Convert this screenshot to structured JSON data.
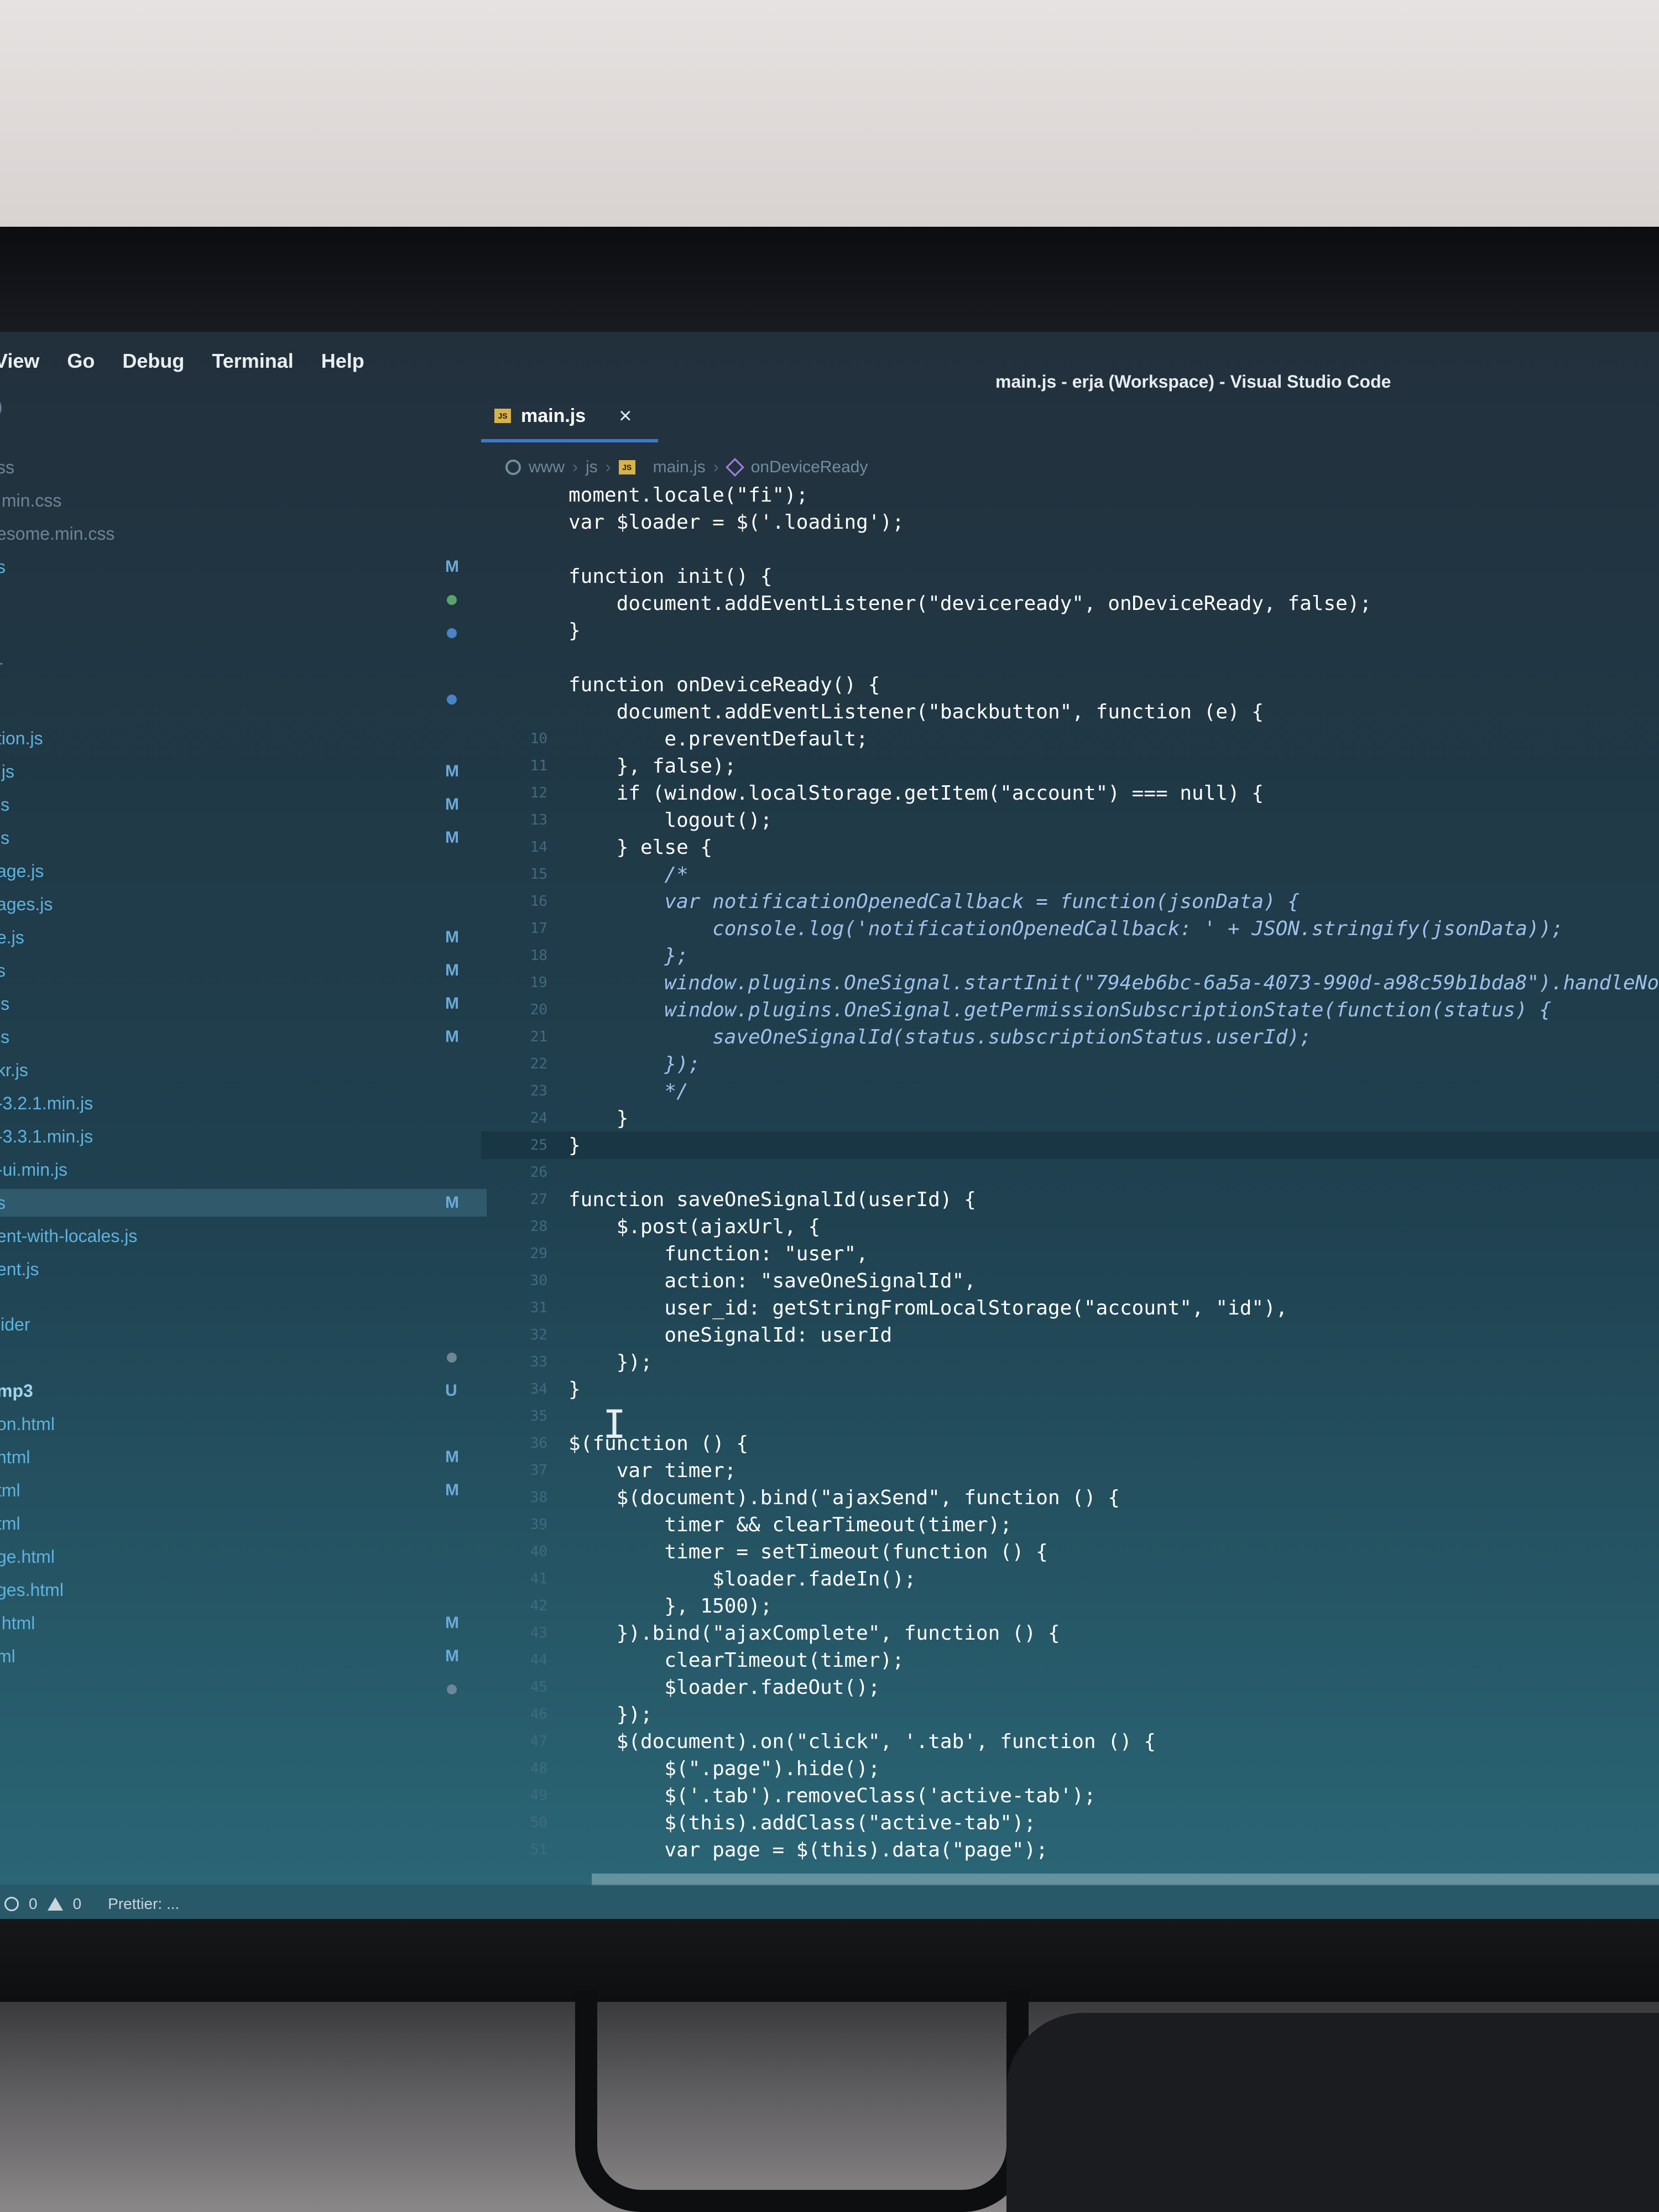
{
  "menu": [
    "View",
    "Go",
    "Debug",
    "Terminal",
    "Help"
  ],
  "window_title": "main.js - erja (Workspace) - Visual Studio Code",
  "tab": {
    "label": "main.js",
    "close": "×"
  },
  "breadcrumb": {
    "folder1": "www",
    "folder2": "js",
    "file": "main.js",
    "symbol": "onDeviceReady"
  },
  "sidebar": [
    {
      "name": ")",
      "status": "",
      "style": "dim"
    },
    {
      "name": "ss",
      "status": "",
      "style": "dim"
    },
    {
      "name": ".min.css",
      "status": "",
      "style": "dim"
    },
    {
      "name": "esome.min.css",
      "status": "",
      "style": "dim"
    },
    {
      "name": "s",
      "status": "M",
      "style": ""
    },
    {
      "name": "",
      "status": "dot-green",
      "style": ""
    },
    {
      "name": "",
      "status": "dot",
      "style": ""
    },
    {
      "name": "r",
      "status": "",
      "style": "dim"
    },
    {
      "name": "",
      "status": "dot",
      "style": ""
    },
    {
      "name": "tion.js",
      "status": "",
      "style": ""
    },
    {
      "name": ".js",
      "status": "M",
      "style": ""
    },
    {
      "name": "js",
      "status": "M",
      "style": ""
    },
    {
      "name": "js",
      "status": "M",
      "style": ""
    },
    {
      "name": "age.js",
      "status": "",
      "style": ""
    },
    {
      "name": "ages.js",
      "status": "",
      "style": ""
    },
    {
      "name": "e.js",
      "status": "M",
      "style": ""
    },
    {
      "name": "s",
      "status": "M",
      "style": ""
    },
    {
      "name": "js",
      "status": "M",
      "style": ""
    },
    {
      "name": "js",
      "status": "M",
      "style": ""
    },
    {
      "name": "kr.js",
      "status": "",
      "style": ""
    },
    {
      "name": "-3.2.1.min.js",
      "status": "",
      "style": ""
    },
    {
      "name": "-3.3.1.min.js",
      "status": "",
      "style": ""
    },
    {
      "name": "-ui.min.js",
      "status": "",
      "style": ""
    },
    {
      "name": "s",
      "status": "M",
      "style": "selected"
    },
    {
      "name": "ent-with-locales.js",
      "status": "",
      "style": ""
    },
    {
      "name": "ent.js",
      "status": "",
      "style": ""
    },
    {
      "name": "lider",
      "status": "",
      "style": ""
    },
    {
      "name": "",
      "status": "dot-gray",
      "style": ""
    },
    {
      "name": "mp3",
      "status": "U",
      "style": "bright"
    },
    {
      "name": "on.html",
      "status": "",
      "style": ""
    },
    {
      "name": "html",
      "status": "M",
      "style": ""
    },
    {
      "name": "tml",
      "status": "M",
      "style": ""
    },
    {
      "name": "tml",
      "status": "",
      "style": ""
    },
    {
      "name": "ge.html",
      "status": "",
      "style": ""
    },
    {
      "name": "ges.html",
      "status": "",
      "style": ""
    },
    {
      "name": ".html",
      "status": "M",
      "style": ""
    },
    {
      "name": "ml",
      "status": "M",
      "style": ""
    },
    {
      "name": "",
      "status": "dot-gray",
      "style": ""
    }
  ],
  "code": [
    {
      "n": "",
      "t": "moment.locale(\"fi\");"
    },
    {
      "n": "",
      "t": "var $loader = $('.loading');"
    },
    {
      "n": "",
      "t": ""
    },
    {
      "n": "",
      "t": "function init() {"
    },
    {
      "n": "",
      "t": "    document.addEventListener(\"deviceready\", onDeviceReady, false);"
    },
    {
      "n": "",
      "t": "}"
    },
    {
      "n": "",
      "t": ""
    },
    {
      "n": "",
      "t": "function onDeviceReady() {"
    },
    {
      "n": "",
      "t": "    document.addEventListener(\"backbutton\", function (e) {"
    },
    {
      "n": "10",
      "t": "        e.preventDefault;"
    },
    {
      "n": "11",
      "t": "    }, false);"
    },
    {
      "n": "12",
      "t": "    if (window.localStorage.getItem(\"account\") === null) {"
    },
    {
      "n": "13",
      "t": "        logout();"
    },
    {
      "n": "14",
      "t": "    } else {"
    },
    {
      "n": "15",
      "t": "        /*",
      "c": true
    },
    {
      "n": "16",
      "t": "        var notificationOpenedCallback = function(jsonData) {",
      "c": true
    },
    {
      "n": "17",
      "t": "            console.log('notificationOpenedCallback: ' + JSON.stringify(jsonData));",
      "c": true
    },
    {
      "n": "18",
      "t": "        };",
      "c": true
    },
    {
      "n": "19",
      "t": "        window.plugins.OneSignal.startInit(\"794eb6bc-6a5a-4073-990d-a98c59b1bda8\").handleNo",
      "c": true
    },
    {
      "n": "20",
      "t": "        window.plugins.OneSignal.getPermissionSubscriptionState(function(status) {",
      "c": true
    },
    {
      "n": "21",
      "t": "            saveOneSignalId(status.subscriptionStatus.userId);",
      "c": true
    },
    {
      "n": "22",
      "t": "        });",
      "c": true
    },
    {
      "n": "23",
      "t": "        */",
      "c": true
    },
    {
      "n": "24",
      "t": "    }"
    },
    {
      "n": "25",
      "t": "}",
      "current": true
    },
    {
      "n": "26",
      "t": ""
    },
    {
      "n": "27",
      "t": "function saveOneSignalId(userId) {"
    },
    {
      "n": "28",
      "t": "    $.post(ajaxUrl, {"
    },
    {
      "n": "29",
      "t": "        function: \"user\","
    },
    {
      "n": "30",
      "t": "        action: \"saveOneSignalId\","
    },
    {
      "n": "31",
      "t": "        user_id: getStringFromLocalStorage(\"account\", \"id\"),"
    },
    {
      "n": "32",
      "t": "        oneSignalId: userId"
    },
    {
      "n": "33",
      "t": "    });"
    },
    {
      "n": "34",
      "t": "}"
    },
    {
      "n": "35",
      "t": ""
    },
    {
      "n": "36",
      "t": "$(function () {"
    },
    {
      "n": "37",
      "t": "    var timer;"
    },
    {
      "n": "38",
      "t": "    $(document).bind(\"ajaxSend\", function () {"
    },
    {
      "n": "39",
      "t": "        timer && clearTimeout(timer);"
    },
    {
      "n": "40",
      "t": "        timer = setTimeout(function () {"
    },
    {
      "n": "41",
      "t": "            $loader.fadeIn();"
    },
    {
      "n": "42",
      "t": "        }, 1500);"
    },
    {
      "n": "43",
      "t": "    }).bind(\"ajaxComplete\", function () {"
    },
    {
      "n": "44",
      "t": "        clearTimeout(timer);"
    },
    {
      "n": "45",
      "t": "        $loader.fadeOut();"
    },
    {
      "n": "46",
      "t": "    });"
    },
    {
      "n": "47",
      "t": "    $(document).on(\"click\", '.tab', function () {"
    },
    {
      "n": "48",
      "t": "        $(\".page\").hide();"
    },
    {
      "n": "49",
      "t": "        $('.tab').removeClass('active-tab');"
    },
    {
      "n": "50",
      "t": "        $(this).addClass(\"active-tab\");"
    },
    {
      "n": "51",
      "t": "        var page = $(this).data(\"page\");"
    }
  ],
  "statusbar": {
    "errors": "0",
    "warnings": "0",
    "prettier": "Prettier: ..."
  },
  "colors": {
    "accent": "#3a79d6",
    "modified": "#6ba9d8",
    "comment": "#9fc0ea"
  }
}
